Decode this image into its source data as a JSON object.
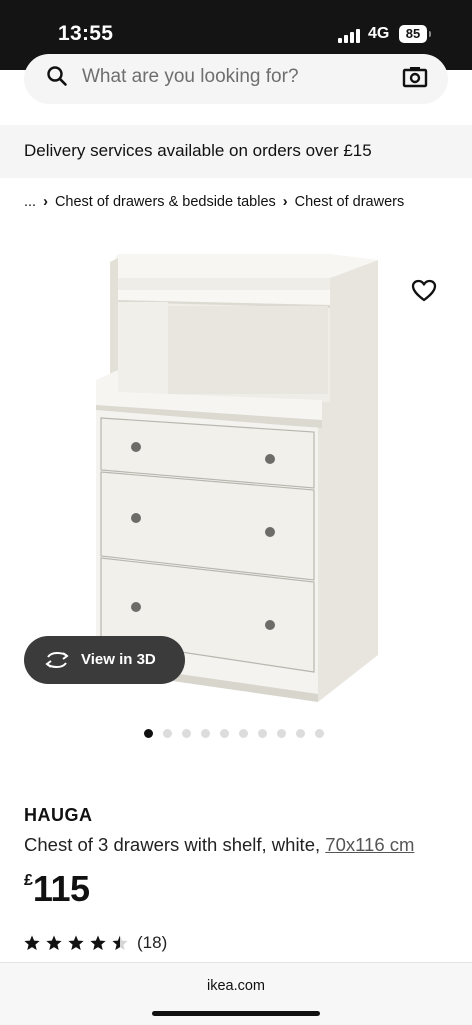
{
  "status_bar": {
    "time": "13:55",
    "network": "4G",
    "battery": "85"
  },
  "search": {
    "placeholder": "What are you looking for?"
  },
  "banner": {
    "text": "Delivery services available on orders over £15"
  },
  "breadcrumb": {
    "items": [
      "...",
      "Chest of drawers & bedside tables",
      "Chest of drawers"
    ],
    "separator": "›"
  },
  "product_image": {
    "view3d_label": "View in 3D"
  },
  "carousel": {
    "total": 10,
    "active": 1
  },
  "product": {
    "name": "HAUGA",
    "description": "Chest of 3 drawers with shelf, white, ",
    "size": "70x116 cm",
    "price_currency": "£",
    "price_amount": "115",
    "rating": 4.5,
    "review_count": "(18)"
  },
  "browser": {
    "url": "ikea.com"
  },
  "colors": {
    "status_bar": "#141414",
    "view3d_button": "#3b3b3b",
    "banner_bg": "#f5f5f5"
  },
  "icons": [
    "search-icon",
    "camera-icon",
    "heart-icon",
    "rotate-3d-icon",
    "star-icon"
  ]
}
